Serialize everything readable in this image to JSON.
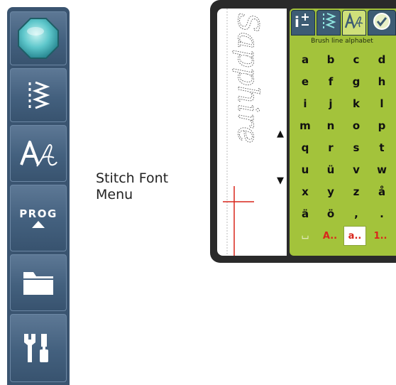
{
  "toolbar": {
    "buttons": [
      {
        "name": "home-button",
        "icon": "octagon-gem-icon"
      },
      {
        "name": "stitch-menu-button",
        "icon": "zigzag-stitch-icon"
      },
      {
        "name": "stitch-font-menu-button",
        "icon": "stitch-font-icon"
      },
      {
        "name": "prog-button",
        "label": "PROG",
        "icon": "up-triangle-icon"
      },
      {
        "name": "file-manager-button",
        "icon": "folder-icon"
      },
      {
        "name": "settings-button",
        "icon": "tools-icon"
      }
    ],
    "prog_label": "PROG"
  },
  "callout": {
    "line1": "Stitch Font",
    "line2": "Menu"
  },
  "screen": {
    "preview_text": "Sapphire",
    "arrows": {
      "up": "▲",
      "down": "▼"
    },
    "tabs": [
      {
        "name": "info-tab",
        "icon": "info-plus-minus-icon"
      },
      {
        "name": "stitch-tab",
        "icon": "zigzag-stitch-icon"
      },
      {
        "name": "font-tab",
        "icon": "stitch-font-icon",
        "active": true
      },
      {
        "name": "confirm-tab",
        "icon": "checkmark-icon"
      }
    ],
    "alphabet_title": "Brush line alphabet",
    "keys": [
      "a",
      "b",
      "c",
      "d",
      "e",
      "f",
      "g",
      "h",
      "i",
      "j",
      "k",
      "l",
      "m",
      "n",
      "o",
      "p",
      "q",
      "r",
      "s",
      "t",
      "u",
      "ü",
      "v",
      "w",
      "x",
      "y",
      "z",
      "å",
      "ä",
      "ö",
      ",",
      "."
    ],
    "bottom_keys": {
      "space": "⌴",
      "upper": "A..",
      "lower": "a..",
      "numbers": "1.."
    },
    "colors": {
      "panel": "#a3c33b",
      "accent_red": "#d9261c",
      "tab_dark": "#3d5c74"
    }
  }
}
